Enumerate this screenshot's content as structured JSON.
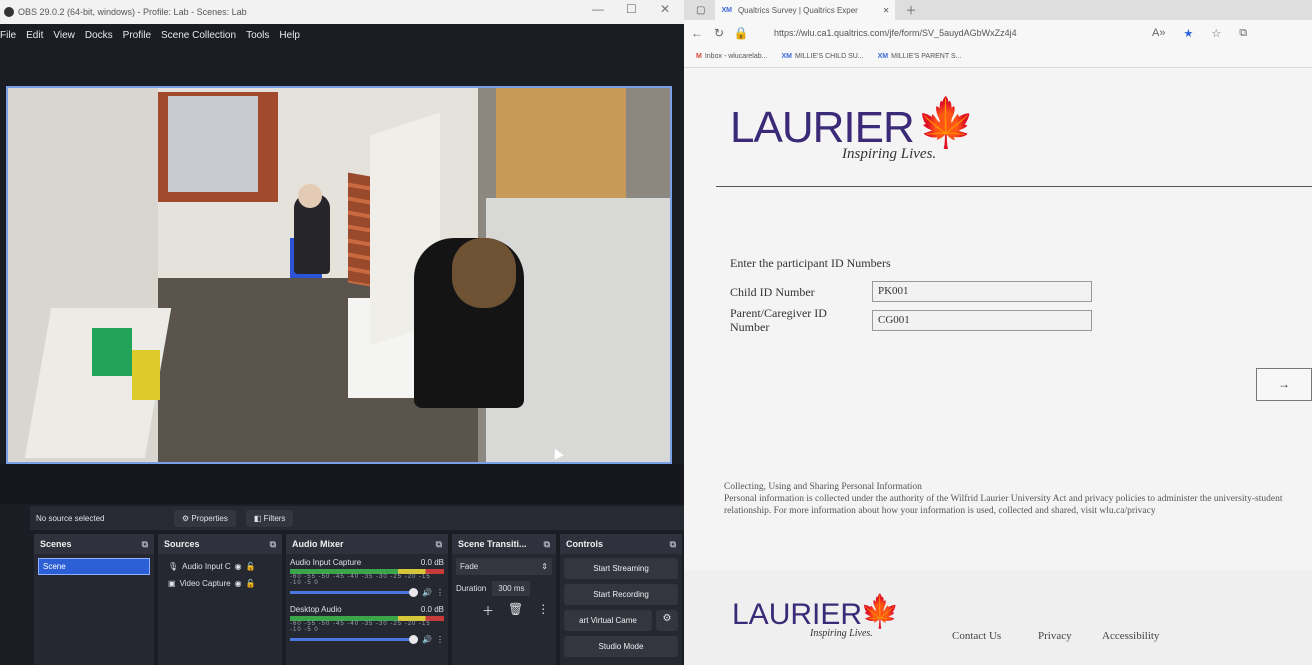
{
  "obs": {
    "title": "OBS 29.0.2 (64-bit, windows) - Profile: Lab - Scenes: Lab",
    "menu": [
      "File",
      "Edit",
      "View",
      "Docks",
      "Profile",
      "Scene Collection",
      "Tools",
      "Help"
    ],
    "source_bar": {
      "status": "No source selected",
      "properties": "Properties",
      "filters": "Filters"
    },
    "scenes": {
      "header": "Scenes",
      "items": [
        "Scene"
      ]
    },
    "sources": {
      "header": "Sources",
      "items": [
        {
          "label": "Audio Input C",
          "icon": "microphone-icon"
        },
        {
          "label": "Video Capture",
          "icon": "camera-icon"
        }
      ]
    },
    "mixer": {
      "header": "Audio Mixer",
      "scale": "-60 -55 -50 -45 -40 -35 -30 -25 -20 -15 -10 -5 0",
      "channels": [
        {
          "name": "Audio Input Capture",
          "level": "0.0 dB"
        },
        {
          "name": "Desktop Audio",
          "level": "0.0 dB"
        }
      ]
    },
    "transitions": {
      "header": "Scene Transiti...",
      "selected": "Fade",
      "duration_label": "Duration",
      "duration_value": "300 ms"
    },
    "controls": {
      "header": "Controls",
      "start_streaming": "Start Streaming",
      "start_recording": "Start Recording",
      "virtual_camera": "art Virtual Came",
      "studio_mode": "Studio Mode"
    }
  },
  "browser": {
    "tab_title": "Qualtrics Survey | Qualtrics Exper",
    "tab_brand": "XM",
    "url": "https://wlu.ca1.qualtrics.com/jfe/form/SV_5auydAGbWxZz4j4",
    "bookmarks": [
      {
        "brand": "M",
        "label": "Inbox - wlucarelab..."
      },
      {
        "brand": "XM",
        "label": "MILLIE'S CHILD SU..."
      },
      {
        "brand": "XM",
        "label": "MILLIE'S PARENT S..."
      }
    ]
  },
  "survey": {
    "logo": "LAURIER",
    "tagline": "Inspiring Lives.",
    "prompt": "Enter the participant ID Numbers",
    "child_label": "Child ID Number",
    "child_value": "PK001",
    "parent_label": "Parent/Caregiver ID Number",
    "parent_value": "CG001",
    "next": "→",
    "privacy_title": "Collecting, Using and Sharing Personal Information",
    "privacy_text": "Personal information is collected under the authority of the Wilfrid Laurier University Act and privacy policies to administer the university-student relationship. For more information about how your information is used, collected and shared, visit wlu.ca/privacy"
  },
  "footer": {
    "logo": "LAURIER",
    "tagline": "Inspiring Lives.",
    "links": [
      "Contact Us",
      "Privacy",
      "Accessibility"
    ]
  },
  "colors": {
    "laurier_purple": "#3a2a77",
    "laurier_gold": "#e9a51e",
    "obs_selection": "#2c5ed6",
    "preview_border": "#7aa0e8"
  }
}
